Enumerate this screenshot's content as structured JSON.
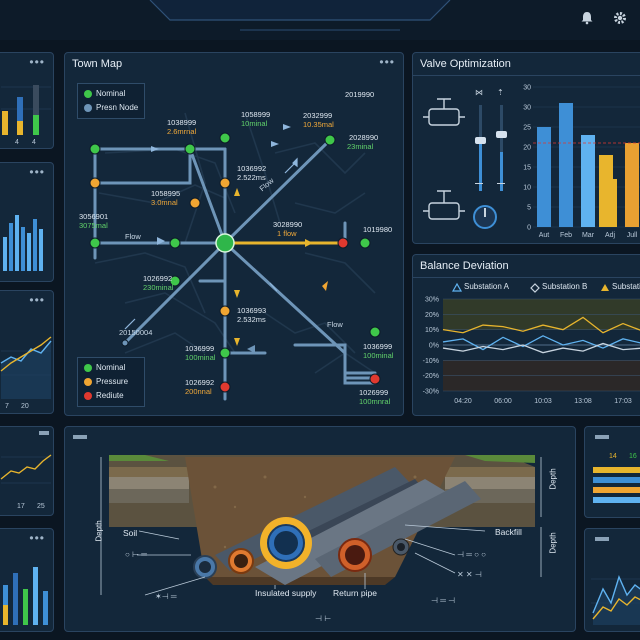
{
  "town_map": {
    "title": "Town Map",
    "legend_top": [
      "Nominal",
      "Presn Node"
    ],
    "legend_bottom": [
      "Nominal",
      "Pressure",
      "Rediute"
    ],
    "labels": [
      {
        "id": "1038999",
        "val": "2.6mrnal"
      },
      {
        "id": "1058999",
        "val": "10minal"
      },
      {
        "id": "2032999",
        "val": "10.35mal"
      },
      {
        "id": "2019990",
        "val": ""
      },
      {
        "id": "2028990",
        "val": "23minal"
      },
      {
        "id": "1036992",
        "val": "2.522ms"
      },
      {
        "id": "1058995",
        "val": "3.0mnal"
      },
      {
        "id": "3056901",
        "val": "3075mal"
      },
      {
        "id": "3028990",
        "val": "1 flow"
      },
      {
        "id": "1019980",
        "val": ""
      },
      {
        "id": "1026992",
        "val": "230minal"
      },
      {
        "id": "1036993",
        "val": "2.532ms"
      },
      {
        "id": "1036999",
        "val": "100minal"
      },
      {
        "id": "1036999",
        "val": "100minal"
      },
      {
        "id": "1026992",
        "val": "200nnal"
      },
      {
        "id": "1026999",
        "val": "100mnral"
      }
    ],
    "flow_labels": [
      "Flow",
      "Flow",
      "Flow",
      "Flow"
    ],
    "node_code": "20150004"
  },
  "valve_optimization": {
    "title": "Valve Optimization",
    "slider_levels": [
      0.55,
      0.45
    ],
    "chart_data": {
      "type": "bar",
      "categories": [
        "Aut",
        "Feb",
        "Mar",
        "Adj",
        "Jull"
      ],
      "series": [
        {
          "values": [
            25,
            31,
            23,
            12,
            21
          ]
        },
        {
          "values": [
            null,
            null,
            null,
            18,
            null
          ]
        }
      ],
      "yticks": [
        "0",
        "5",
        "10",
        "15",
        "20",
        "25",
        "30",
        "30"
      ],
      "ylim": [
        0,
        35
      ],
      "reference_line": 21
    }
  },
  "balance_deviation": {
    "title": "Balance Deviation",
    "legend": [
      "Substation A",
      "Substation B",
      "Substation"
    ],
    "chart_data": {
      "type": "line",
      "x": [
        "04:20",
        "06:00",
        "10:03",
        "13:08",
        "17:03"
      ],
      "yticks": [
        "30%",
        "20%",
        "10%",
        "0%",
        "-10%",
        "-20%",
        "-30%"
      ],
      "ylim": [
        -30,
        30
      ],
      "series": [
        {
          "name": "Substation A",
          "values": [
            2,
            4,
            -3,
            5,
            -1,
            6,
            0,
            3,
            -2,
            4,
            1
          ]
        },
        {
          "name": "Substation B",
          "values": [
            -2,
            -4,
            -1,
            -3,
            0,
            -5,
            -2,
            -4,
            1,
            -3,
            -2
          ]
        },
        {
          "name": "Substation",
          "values": [
            10,
            8,
            13,
            12,
            9,
            13,
            10,
            18,
            8,
            14,
            9
          ]
        }
      ]
    }
  },
  "cross_section": {
    "labels": {
      "depth_left": "Depth",
      "depth_right_top": "Depth",
      "depth_right_bottom": "Depth",
      "soil": "Soil",
      "insulated_supply": "Insulated supply",
      "return_pipe": "Return pipe",
      "backfill": "Backfill"
    }
  },
  "left_widgets": {
    "w1_ticks": [
      "4",
      "4"
    ],
    "w4_ticks": [
      "7",
      "20"
    ],
    "w5_ticks": [
      "17",
      "25"
    ]
  },
  "right_widgets": {
    "w1_ticks": [
      "14",
      "16"
    ]
  },
  "colors": {
    "green": "#3fc74a",
    "orange": "#f0a532",
    "red": "#e0392f",
    "blue": "#3e8fd6",
    "yellow": "#e8b52d",
    "pipe": "#6e95b8"
  }
}
